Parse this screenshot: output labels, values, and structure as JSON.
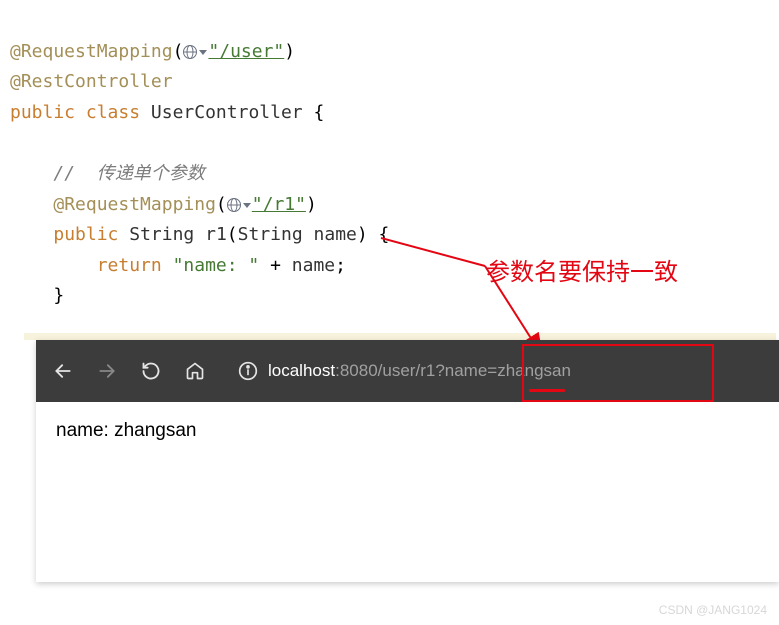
{
  "code": {
    "ann_requestmapping": "@RequestMapping",
    "ann_restcontroller": "@RestController",
    "user_path": "\"/user\"",
    "kw_public": "public",
    "kw_class": "class",
    "class_name": "UserController",
    "brace_open": "{",
    "comment_pass": "//  传递单个参数",
    "r1_path": "\"/r1\"",
    "type_string": "String",
    "method_r1": "r1",
    "param_name": "name",
    "paren_sig_close": ") {",
    "kw_return": "return",
    "str_name": "\"name: \"",
    "plus": " + ",
    "semi": ";",
    "brace_close": "}"
  },
  "callout_text": "参数名要保持一致",
  "browser": {
    "url_host": "localhost",
    "url_port": ":8080",
    "url_path_pre": "/user/",
    "url_r1": "r1",
    "url_query": "?name=zhangsan",
    "body": "name: zhangsan"
  },
  "watermark": "CSDN @JANG1024"
}
